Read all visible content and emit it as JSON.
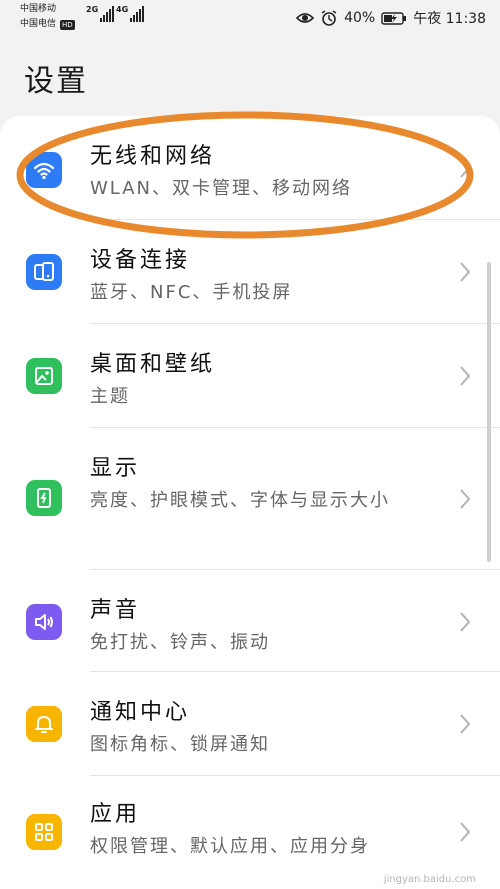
{
  "status_bar": {
    "carrier_1": "中国移动",
    "carrier_2": "中国电信",
    "hd": "HD",
    "net_1": "2G",
    "net_2": "4G",
    "battery": "40%",
    "time": "午夜 11:38"
  },
  "header": {
    "title": "设置"
  },
  "items": [
    {
      "title": "无线和网络",
      "subtitle": "WLAN、双卡管理、移动网络",
      "icon": "wifi-icon",
      "color": "#2d7cf6"
    },
    {
      "title": "设备连接",
      "subtitle": "蓝牙、NFC、手机投屏",
      "icon": "device-connection-icon",
      "color": "#2d7cf6"
    },
    {
      "title": "桌面和壁纸",
      "subtitle": "主题",
      "icon": "wallpaper-icon",
      "color": "#2fbf5d"
    },
    {
      "title": "显示",
      "subtitle": "亮度、护眼模式、字体与显示大小",
      "icon": "display-icon",
      "color": "#2fbf5d"
    },
    {
      "title": "声音",
      "subtitle": "免打扰、铃声、振动",
      "icon": "speaker-icon",
      "color": "#7e5bf0"
    },
    {
      "title": "通知中心",
      "subtitle": "图标角标、锁屏通知",
      "icon": "bell-icon",
      "color": "#f7b500"
    },
    {
      "title": "应用",
      "subtitle": "权限管理、默认应用、应用分身",
      "icon": "apps-grid-icon",
      "color": "#f7b500"
    }
  ],
  "watermark": "jingyan.baidu.com"
}
